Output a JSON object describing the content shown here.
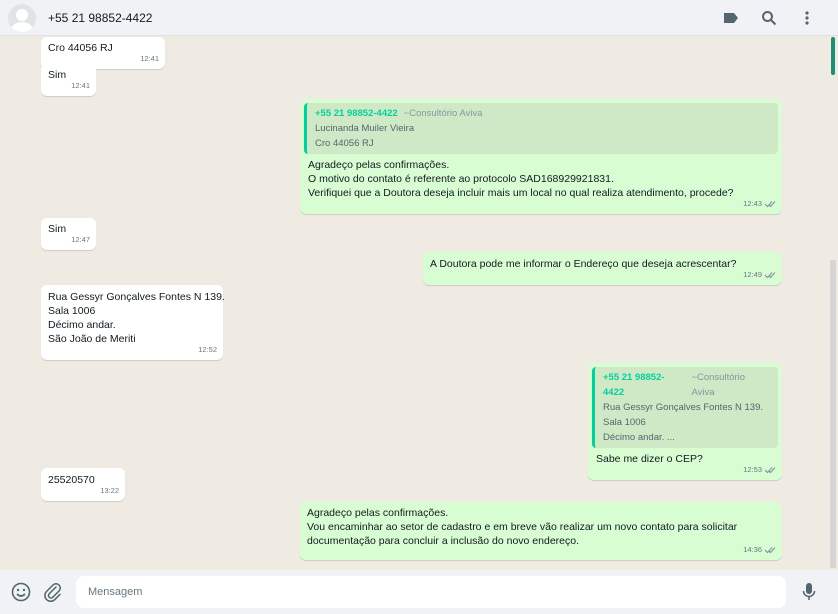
{
  "header": {
    "contact": "+55 21 98852-4422"
  },
  "messages": [
    {
      "lines": [
        "Cro 44056 RJ"
      ],
      "time": "12:41"
    },
    {
      "lines": [
        "Sim"
      ],
      "time": "12:41"
    },
    {
      "quote": {
        "number": "+55 21 98852-4422",
        "name": "~Consultório Aviva",
        "lines": [
          "Lucinanda Muiler Vieira",
          "Cro 44056 RJ"
        ]
      },
      "lines": [
        "Agradeço pelas confirmações.",
        "O motivo do contato é referente ao protocolo SAD168929921831.",
        "Verifiquei que a Doutora deseja incluir mais um local no qual realiza atendimento, procede?"
      ],
      "time": "12:43"
    },
    {
      "lines": [
        "Sim"
      ],
      "time": "12:47"
    },
    {
      "lines": [
        "A Doutora pode me informar o Endereço que deseja acrescentar?"
      ],
      "time": "12:49"
    },
    {
      "lines": [
        "Rua Gessyr Gonçalves Fontes N 139.",
        "Sala 1006",
        "Décimo andar.",
        "São João de Meriti"
      ],
      "time": "12:52"
    },
    {
      "quote": {
        "number": "+55 21 98852-4422",
        "name": "~Consultório Aviva",
        "lines": [
          "Rua Gessyr Gonçalves Fontes N 139.",
          "Sala 1006",
          "Décimo andar. ..."
        ]
      },
      "lines": [
        "Sabe me dizer o CEP?"
      ],
      "time": "12:53"
    },
    {
      "lines": [
        "25520570"
      ],
      "time": "13:22"
    },
    {
      "lines": [
        "Agradeço pelas confirmações.",
        "Vou encaminhar ao setor de cadastro e em breve vão realizar um novo contato para solicitar",
        "documentação para concluir a inclusão do novo endereço."
      ],
      "time": "14:36"
    }
  ],
  "composer": {
    "placeholder": "Mensagem"
  },
  "icons": {
    "header": [
      "label-icon",
      "search-icon",
      "menu-icon"
    ],
    "footer": [
      "emoji-icon",
      "attach-icon",
      "mic-icon"
    ]
  },
  "colors": {
    "outgoing": "#d9fdd3",
    "incoming": "#ffffff",
    "accent": "#06cf9c",
    "background": "#efeae2"
  }
}
